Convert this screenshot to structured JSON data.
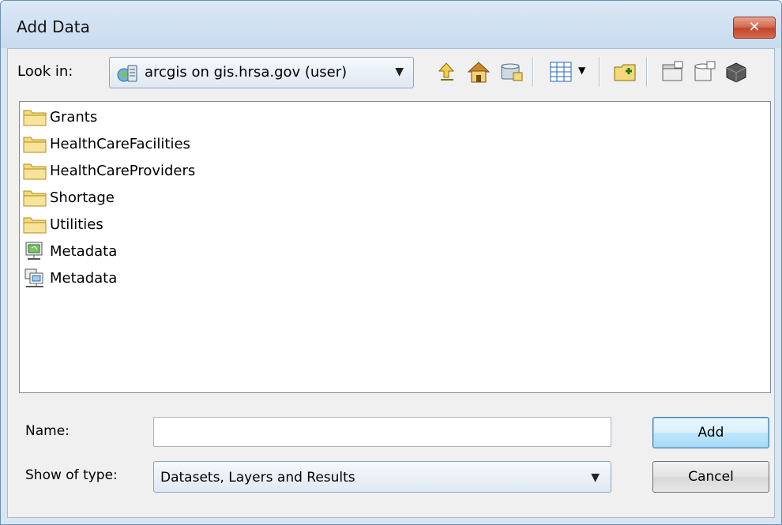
{
  "window": {
    "title": "Add Data",
    "close_glyph": "✕"
  },
  "lookin": {
    "label": "Look in:",
    "value": "arcgis on gis.hrsa.gov (user)",
    "icon": "arcgis-server-icon"
  },
  "toolbar": {
    "icons": [
      "up-one-level-icon",
      "home-icon",
      "connect-to-folder-icon",
      "view-mode-icon",
      "chevron-down-icon",
      "new-folder-icon",
      "catalog-icon",
      "new-database-icon",
      "toolbox-icon"
    ]
  },
  "files": [
    {
      "label": "Grants",
      "icon": "folder-icon"
    },
    {
      "label": "HealthCareFacilities",
      "icon": "folder-icon"
    },
    {
      "label": "HealthCareProviders",
      "icon": "folder-icon"
    },
    {
      "label": "Shortage",
      "icon": "folder-icon"
    },
    {
      "label": "Utilities",
      "icon": "folder-icon"
    },
    {
      "label": "Metadata",
      "icon": "map-service-icon"
    },
    {
      "label": "Metadata",
      "icon": "feature-service-icon"
    }
  ],
  "name": {
    "label": "Name:",
    "value": "",
    "placeholder": ""
  },
  "type": {
    "label": "Show of type:",
    "value": "Datasets, Layers and Results"
  },
  "buttons": {
    "add": "Add",
    "cancel": "Cancel"
  },
  "colors": {
    "folder": "#f3d97a",
    "title_bar": "#c8dbef",
    "close": "#c2452b"
  }
}
